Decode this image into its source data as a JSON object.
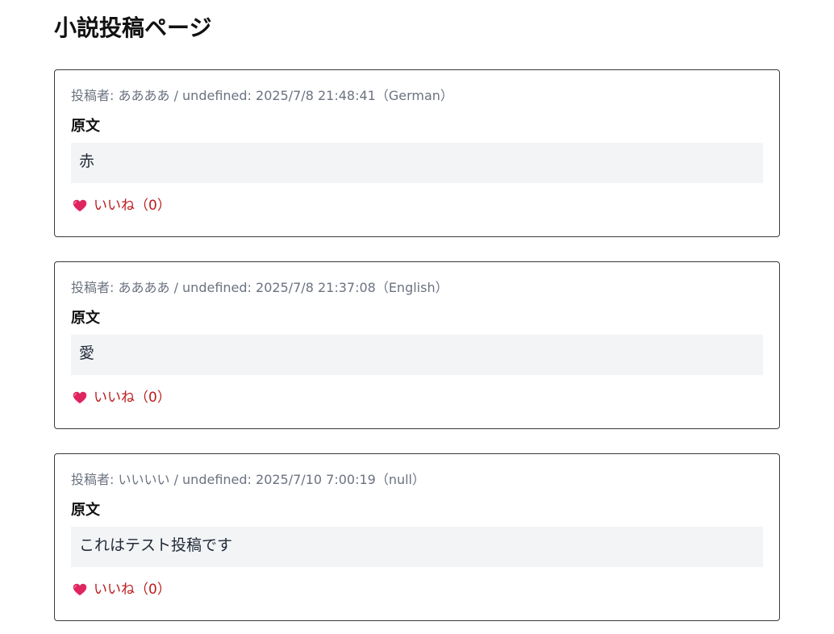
{
  "page": {
    "title": "小説投稿ページ"
  },
  "posts": [
    {
      "meta": "投稿者: ああああ / undefined: 2025/7/8 21:48:41（German）",
      "section_label": "原文",
      "original_text": "赤",
      "like_label": "いいね（0）",
      "like_icon": "heart-icon"
    },
    {
      "meta": "投稿者: ああああ / undefined: 2025/7/8 21:37:08（English）",
      "section_label": "原文",
      "original_text": "愛",
      "like_label": "いいね（0）",
      "like_icon": "heart-icon"
    },
    {
      "meta": "投稿者: いいいい / undefined: 2025/7/10 7:00:19（null）",
      "section_label": "原文",
      "original_text": "これはテスト投稿です",
      "like_label": "いいね（0）",
      "like_icon": "heart-icon"
    }
  ],
  "colors": {
    "like_text": "#b91c1c",
    "heart": "#e0245e",
    "meta_text": "#6b7280",
    "text_box_bg": "#f3f4f6",
    "card_border": "#3a3a3a"
  }
}
